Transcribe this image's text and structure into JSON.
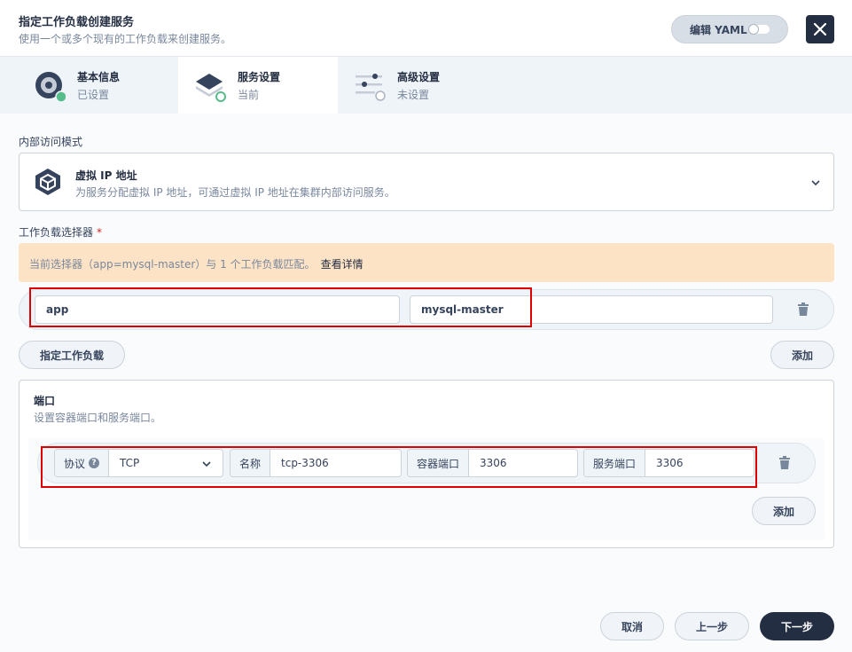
{
  "header": {
    "title": "指定工作负载创建服务",
    "subtitle": "使用一个或多个现有的工作负载来创建服务。",
    "yaml_label": "编辑 YAML"
  },
  "steps": [
    {
      "label": "基本信息",
      "status": "已设置"
    },
    {
      "label": "服务设置",
      "status": "当前"
    },
    {
      "label": "高级设置",
      "status": "未设置"
    }
  ],
  "access_mode": {
    "label": "内部访问模式",
    "option_title": "虚拟 IP 地址",
    "option_desc": "为服务分配虚拟 IP 地址，可通过虚拟 IP 地址在集群内部访问服务。"
  },
  "selector": {
    "label": "工作负载选择器",
    "required_mark": "*",
    "info_text": "当前选择器（app=mysql-master）与 1 个工作负载匹配。",
    "info_link": "查看详情",
    "key_value": "app",
    "value_value": "mysql-master",
    "specify_button": "指定工作负载",
    "add_button": "添加"
  },
  "ports": {
    "title": "端口",
    "desc": "设置容器端口和服务端口。",
    "protocol_label": "协议",
    "protocol_help": "?",
    "protocol_value": "TCP",
    "name_label": "名称",
    "name_value": "tcp-3306",
    "container_port_label": "容器端口",
    "container_port_value": "3306",
    "service_port_label": "服务端口",
    "service_port_value": "3306",
    "add_button": "添加"
  },
  "footer": {
    "cancel": "取消",
    "previous": "上一步",
    "next": "下一步"
  },
  "colors": {
    "dark": "#242e42",
    "highlight": "#e00000",
    "warning_bg": "#fde3c6",
    "success": "#55bc8a"
  }
}
